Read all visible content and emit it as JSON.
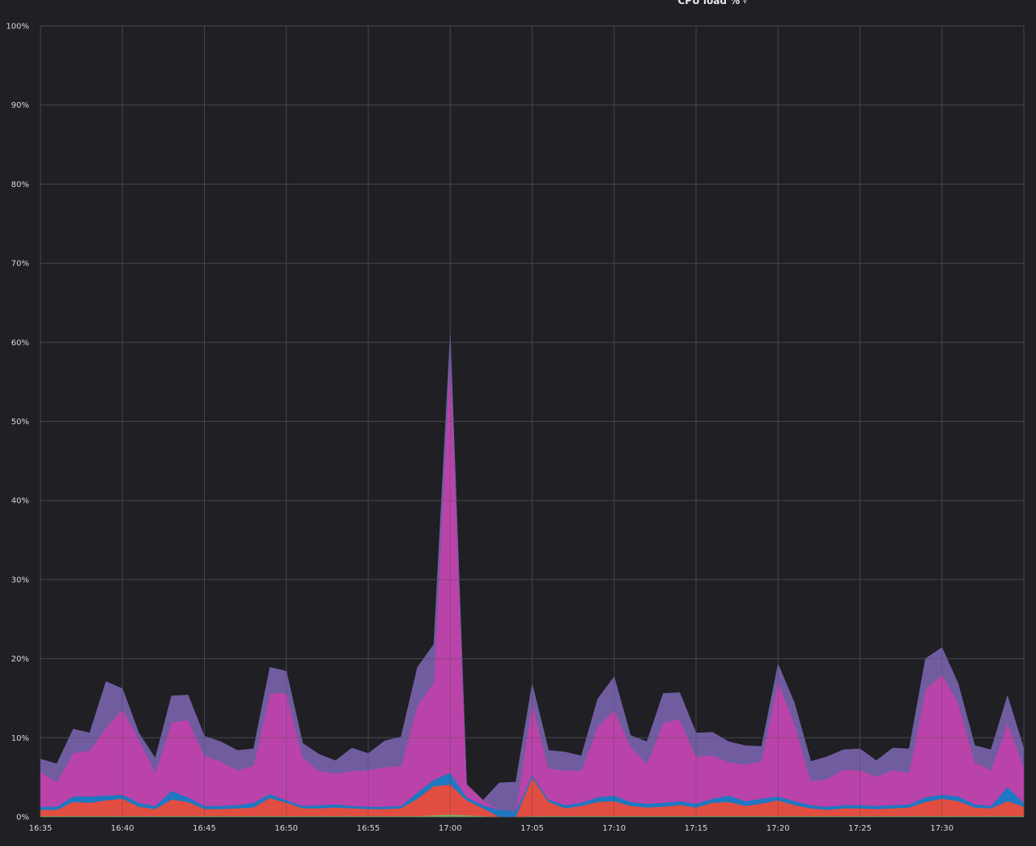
{
  "panel": {
    "title": "CPU load %",
    "title_caret": "▾"
  },
  "chart_data": {
    "type": "area",
    "stacked": true,
    "title": "CPU load %",
    "xlabel": "",
    "ylabel": "",
    "ylim": [
      0,
      100
    ],
    "yticks": [
      0,
      10,
      20,
      30,
      40,
      50,
      60,
      70,
      80,
      90,
      100
    ],
    "ytick_labels": [
      "0%",
      "10%",
      "20%",
      "30%",
      "40%",
      "50%",
      "60%",
      "70%",
      "80%",
      "90%",
      "100%"
    ],
    "xlim": [
      "16:35",
      "17:35"
    ],
    "xticks": [
      "16:35",
      "16:40",
      "16:45",
      "16:50",
      "16:55",
      "17:00",
      "17:05",
      "17:10",
      "17:15",
      "17:20",
      "17:25",
      "17:30"
    ],
    "grid": true,
    "legend": "none",
    "colors": [
      "#7eb26d",
      "#e24d42",
      "#1f78c1",
      "#ba43a9",
      "#705da0"
    ],
    "x": [
      "16:35",
      "16:36",
      "16:37",
      "16:38",
      "16:39",
      "16:40",
      "16:41",
      "16:42",
      "16:43",
      "16:44",
      "16:45",
      "16:46",
      "16:47",
      "16:48",
      "16:49",
      "16:50",
      "16:51",
      "16:52",
      "16:53",
      "16:54",
      "16:55",
      "16:56",
      "16:57",
      "16:58",
      "16:59",
      "17:00",
      "17:01",
      "17:02",
      "17:03",
      "17:04",
      "17:05",
      "17:06",
      "17:07",
      "17:08",
      "17:09",
      "17:10",
      "17:11",
      "17:12",
      "17:13",
      "17:14",
      "17:15",
      "17:16",
      "17:17",
      "17:18",
      "17:19",
      "17:20",
      "17:21",
      "17:22",
      "17:23",
      "17:24",
      "17:25",
      "17:26",
      "17:27",
      "17:28",
      "17:29",
      "17:30",
      "17:31",
      "17:32",
      "17:33",
      "17:34",
      "17:35"
    ],
    "series": [
      {
        "values": [
          0.1,
          0.1,
          0.1,
          0.1,
          0.1,
          0.1,
          0.1,
          0.1,
          0.1,
          0.1,
          0.1,
          0.1,
          0.1,
          0.1,
          0.1,
          0.1,
          0.1,
          0.1,
          0.1,
          0.1,
          0.1,
          0.1,
          0.1,
          0.1,
          0.2,
          0.3,
          0.2,
          0.1,
          0.0,
          0.0,
          0.1,
          0.1,
          0.1,
          0.1,
          0.1,
          0.1,
          0.1,
          0.1,
          0.1,
          0.1,
          0.1,
          0.1,
          0.1,
          0.1,
          0.1,
          0.1,
          0.1,
          0.1,
          0.1,
          0.1,
          0.1,
          0.1,
          0.1,
          0.1,
          0.1,
          0.1,
          0.1,
          0.1,
          0.1,
          0.1,
          0.1
        ]
      },
      {
        "values": [
          0.8,
          0.8,
          1.8,
          1.7,
          2.0,
          2.2,
          1.2,
          0.9,
          2.1,
          1.8,
          0.9,
          0.9,
          1.0,
          1.1,
          2.3,
          1.7,
          1.0,
          1.0,
          1.1,
          1.0,
          0.9,
          0.9,
          1.0,
          2.2,
          3.7,
          3.8,
          1.9,
          1.0,
          0.0,
          0.0,
          4.9,
          1.8,
          1.0,
          1.3,
          1.8,
          1.9,
          1.3,
          1.1,
          1.2,
          1.4,
          1.1,
          1.7,
          1.8,
          1.3,
          1.6,
          2.0,
          1.4,
          1.0,
          0.8,
          1.0,
          1.0,
          0.9,
          1.0,
          1.1,
          1.8,
          2.2,
          1.9,
          1.1,
          1.0,
          1.9,
          1.2
        ]
      },
      {
        "values": [
          0.4,
          0.4,
          0.7,
          0.8,
          0.6,
          0.5,
          0.5,
          0.4,
          1.1,
          0.6,
          0.4,
          0.4,
          0.4,
          0.6,
          0.5,
          0.3,
          0.3,
          0.4,
          0.4,
          0.3,
          0.3,
          0.3,
          0.3,
          0.8,
          0.8,
          1.5,
          0.4,
          0.4,
          0.9,
          0.7,
          0.3,
          0.3,
          0.4,
          0.4,
          0.6,
          0.7,
          0.5,
          0.5,
          0.5,
          0.5,
          0.5,
          0.5,
          0.8,
          0.6,
          0.6,
          0.5,
          0.5,
          0.4,
          0.4,
          0.4,
          0.4,
          0.4,
          0.4,
          0.4,
          0.6,
          0.5,
          0.6,
          0.4,
          0.3,
          1.8,
          0.5
        ]
      },
      {
        "values": [
          4.4,
          3.1,
          5.5,
          5.8,
          8.6,
          10.8,
          8.0,
          4.2,
          8.6,
          9.8,
          6.4,
          5.6,
          4.4,
          4.7,
          12.7,
          13.6,
          6.1,
          4.3,
          3.9,
          4.4,
          4.6,
          5.0,
          5.0,
          11.0,
          12.3,
          52.5,
          1.6,
          0.6,
          0.0,
          0.0,
          9.0,
          3.9,
          4.4,
          4.1,
          8.9,
          10.8,
          7.0,
          5.0,
          10.1,
          10.4,
          5.9,
          5.5,
          4.2,
          4.6,
          4.8,
          14.5,
          9.8,
          3.0,
          3.5,
          4.5,
          4.4,
          3.7,
          4.4,
          4.0,
          13.6,
          15.2,
          11.8,
          5.3,
          4.5,
          8.1,
          4.5
        ]
      },
      {
        "values": [
          1.6,
          2.3,
          3.0,
          2.2,
          5.8,
          2.6,
          0.8,
          1.8,
          3.4,
          3.1,
          2.4,
          2.5,
          2.5,
          2.1,
          3.3,
          2.7,
          1.8,
          2.1,
          1.6,
          2.9,
          2.1,
          3.3,
          3.7,
          4.8,
          4.8,
          2.9,
          0.0,
          0.0,
          3.4,
          3.7,
          2.5,
          2.3,
          2.3,
          1.8,
          3.5,
          4.2,
          1.4,
          2.8,
          3.7,
          3.3,
          3.0,
          2.9,
          2.6,
          2.4,
          1.8,
          2.2,
          2.6,
          2.5,
          2.8,
          2.5,
          2.7,
          2.0,
          2.8,
          3.0,
          3.9,
          3.4,
          2.4,
          2.1,
          2.6,
          3.4,
          2.3
        ]
      }
    ]
  }
}
